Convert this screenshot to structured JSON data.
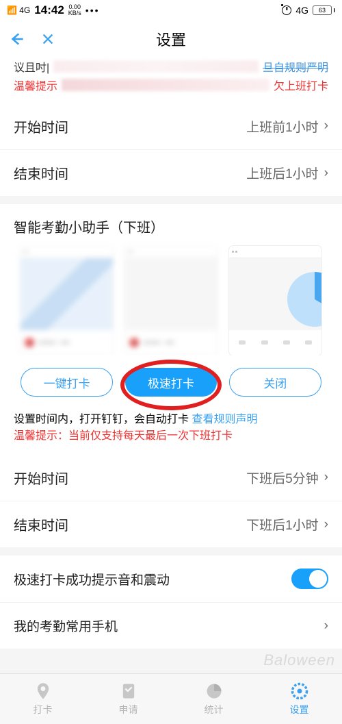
{
  "statusbar": {
    "net_label": "4G",
    "time": "14:42",
    "speed_top": "0.00",
    "speed_bottom": "KB/s",
    "net_right": "4G",
    "battery": "63"
  },
  "nav": {
    "title": "设置"
  },
  "obscured": {
    "line1_prefix": "议且吋|",
    "line1_rule": "旦自规则严明",
    "line2_prefix": "温馨提示",
    "line2_suffix": "欠上班打卡"
  },
  "section1": {
    "start_label": "开始时间",
    "start_value": "上班前1小时",
    "end_label": "结束时间",
    "end_value": "上班后1小时"
  },
  "assistant_title": "智能考勤小助手（下班）",
  "options": {
    "one_click": "一键打卡",
    "fast": "极速打卡",
    "off": "关闭"
  },
  "desc": {
    "text": "设置时间内，打开钉钉，会自动打卡 ",
    "rule": "查看规则声明",
    "warn": "温馨提示：当前仅支持每天最后一次下班打卡"
  },
  "section2": {
    "start_label": "开始时间",
    "start_value": "下班后5分钟",
    "end_label": "结束时间",
    "end_value": "下班后1小时"
  },
  "sound_row": {
    "label": "极速打卡成功提示音和震动"
  },
  "phone_row": {
    "label": "我的考勤常用手机"
  },
  "tabs": {
    "t1": "打卡",
    "t2": "申请",
    "t3": "统计",
    "t4": "设置"
  },
  "watermark": "Baloween"
}
